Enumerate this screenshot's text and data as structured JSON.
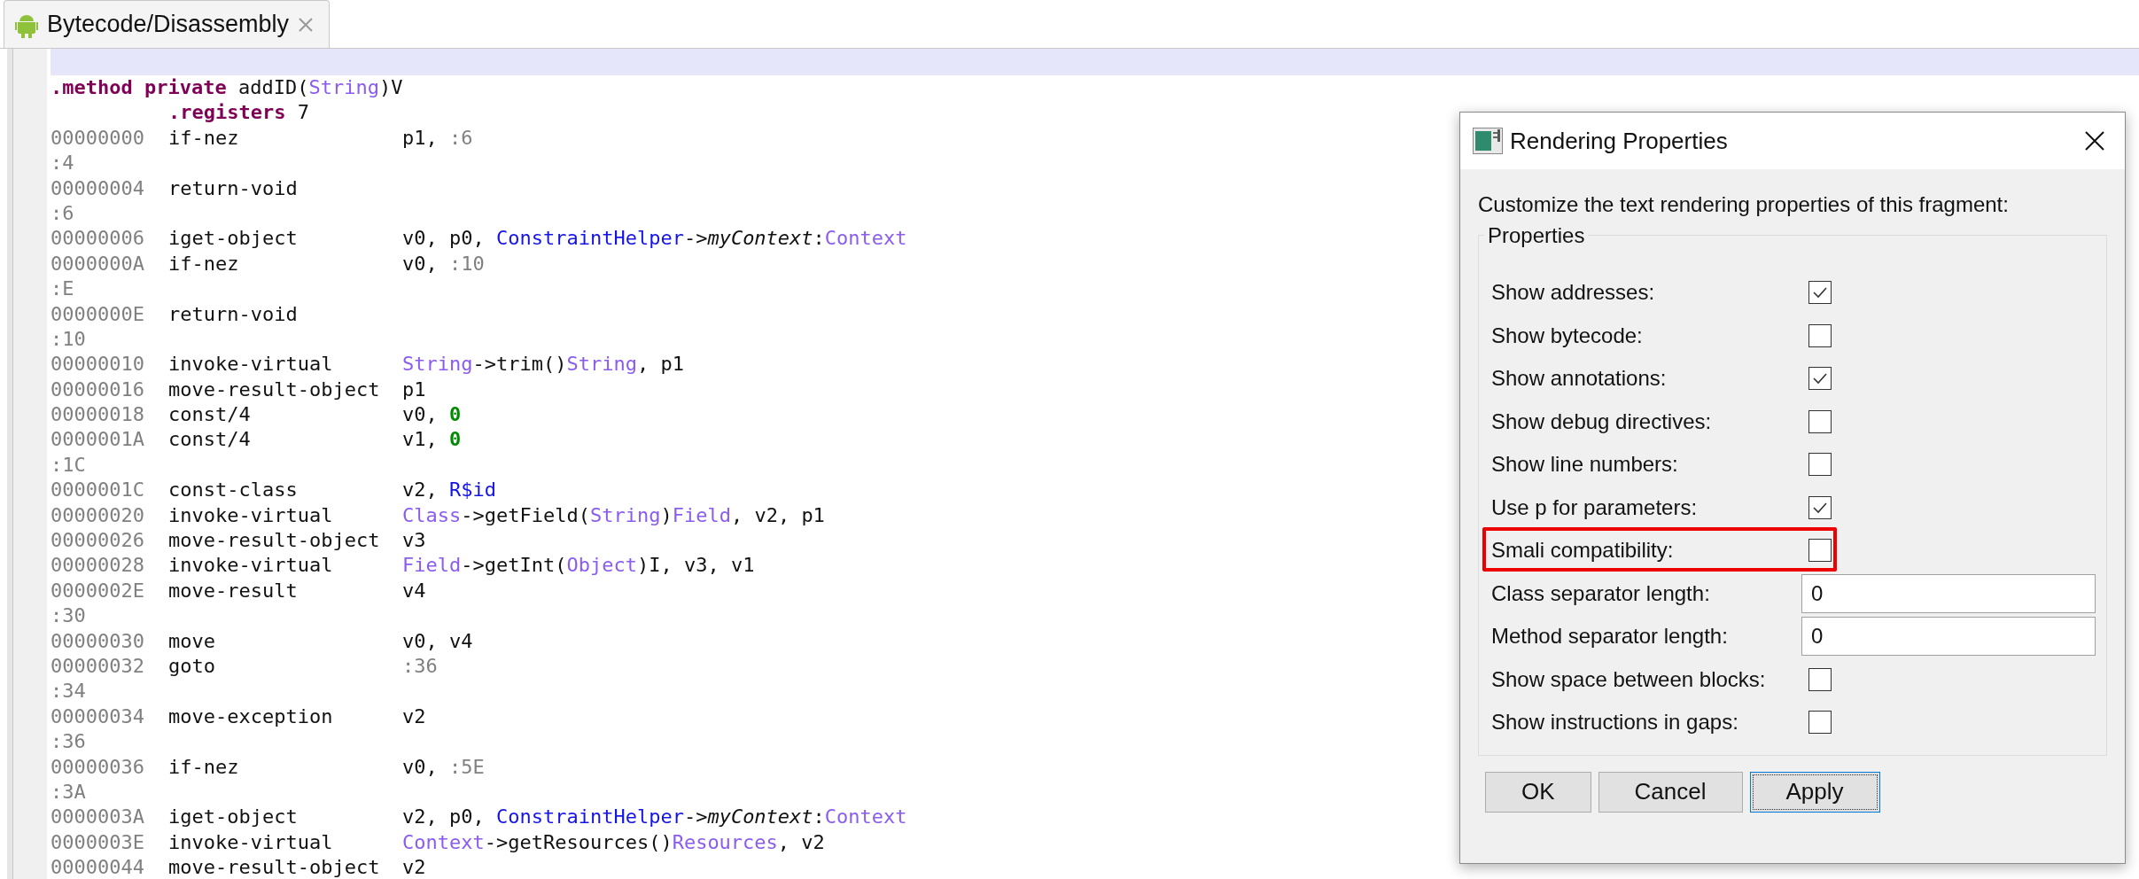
{
  "tab": {
    "title": "Bytecode/Disassembly"
  },
  "code": [
    {
      "kind": "header",
      "tokens": [
        {
          "text": ".method private",
          "kind": "keyword"
        },
        {
          "text": " addID(",
          "kind": "plain"
        },
        {
          "text": "String",
          "kind": "type"
        },
        {
          "text": ")V",
          "kind": "plain"
        }
      ]
    },
    {
      "kind": "directive",
      "tokens": [
        {
          "text": ".registers",
          "kind": "keyword"
        },
        {
          "text": " 7",
          "kind": "plain"
        }
      ]
    },
    {
      "kind": "instruction",
      "address": "00000000",
      "opcode": "if-nez",
      "args": [
        {
          "text": "p1, ",
          "kind": "plain"
        },
        {
          "text": ":6",
          "kind": "label"
        }
      ]
    },
    {
      "kind": "label",
      "text": ":4"
    },
    {
      "kind": "instruction",
      "address": "00000004",
      "opcode": "return-void"
    },
    {
      "kind": "label",
      "text": ":6"
    },
    {
      "kind": "instruction",
      "address": "00000006",
      "opcode": "iget-object",
      "args": [
        {
          "text": "v0, p0, ",
          "kind": "plain"
        },
        {
          "text": "ConstraintHelper",
          "kind": "class"
        },
        {
          "text": "->",
          "kind": "plain"
        },
        {
          "text": "myContext",
          "kind": "field"
        },
        {
          "text": ":",
          "kind": "plain"
        },
        {
          "text": "Context",
          "kind": "type"
        }
      ]
    },
    {
      "kind": "instruction",
      "address": "0000000A",
      "opcode": "if-nez",
      "args": [
        {
          "text": "v0, ",
          "kind": "plain"
        },
        {
          "text": ":10",
          "kind": "label"
        }
      ]
    },
    {
      "kind": "label",
      "text": ":E"
    },
    {
      "kind": "instruction",
      "address": "0000000E",
      "opcode": "return-void"
    },
    {
      "kind": "label",
      "text": ":10"
    },
    {
      "kind": "instruction",
      "address": "00000010",
      "opcode": "invoke-virtual",
      "args": [
        {
          "text": "String",
          "kind": "type"
        },
        {
          "text": "->trim()",
          "kind": "plain"
        },
        {
          "text": "String",
          "kind": "type"
        },
        {
          "text": ", p1",
          "kind": "plain"
        }
      ]
    },
    {
      "kind": "instruction",
      "address": "00000016",
      "opcode": "move-result-object",
      "args": [
        {
          "text": "p1",
          "kind": "plain"
        }
      ]
    },
    {
      "kind": "instruction",
      "address": "00000018",
      "opcode": "const/4",
      "args": [
        {
          "text": "v0, ",
          "kind": "plain"
        },
        {
          "text": "0",
          "kind": "number"
        }
      ]
    },
    {
      "kind": "instruction",
      "address": "0000001A",
      "opcode": "const/4",
      "args": [
        {
          "text": "v1, ",
          "kind": "plain"
        },
        {
          "text": "0",
          "kind": "number"
        }
      ]
    },
    {
      "kind": "label",
      "text": ":1C"
    },
    {
      "kind": "instruction",
      "address": "0000001C",
      "opcode": "const-class",
      "args": [
        {
          "text": "v2, ",
          "kind": "plain"
        },
        {
          "text": "R$id",
          "kind": "class"
        }
      ]
    },
    {
      "kind": "instruction",
      "address": "00000020",
      "opcode": "invoke-virtual",
      "args": [
        {
          "text": "Class",
          "kind": "type"
        },
        {
          "text": "->getField(",
          "kind": "plain"
        },
        {
          "text": "String",
          "kind": "type"
        },
        {
          "text": ")",
          "kind": "plain"
        },
        {
          "text": "Field",
          "kind": "type"
        },
        {
          "text": ", v2, p1",
          "kind": "plain"
        }
      ]
    },
    {
      "kind": "instruction",
      "address": "00000026",
      "opcode": "move-result-object",
      "args": [
        {
          "text": "v3",
          "kind": "plain"
        }
      ]
    },
    {
      "kind": "instruction",
      "address": "00000028",
      "opcode": "invoke-virtual",
      "args": [
        {
          "text": "Field",
          "kind": "type"
        },
        {
          "text": "->getInt(",
          "kind": "plain"
        },
        {
          "text": "Object",
          "kind": "type"
        },
        {
          "text": ")I, v3, v1",
          "kind": "plain"
        }
      ]
    },
    {
      "kind": "instruction",
      "address": "0000002E",
      "opcode": "move-result",
      "args": [
        {
          "text": "v4",
          "kind": "plain"
        }
      ]
    },
    {
      "kind": "label",
      "text": ":30"
    },
    {
      "kind": "instruction",
      "address": "00000030",
      "opcode": "move",
      "args": [
        {
          "text": "v0, v4",
          "kind": "plain"
        }
      ]
    },
    {
      "kind": "instruction",
      "address": "00000032",
      "opcode": "goto",
      "args": [
        {
          "text": ":36",
          "kind": "label"
        }
      ]
    },
    {
      "kind": "label",
      "text": ":34"
    },
    {
      "kind": "instruction",
      "address": "00000034",
      "opcode": "move-exception",
      "args": [
        {
          "text": "v2",
          "kind": "plain"
        }
      ]
    },
    {
      "kind": "label",
      "text": ":36"
    },
    {
      "kind": "instruction",
      "address": "00000036",
      "opcode": "if-nez",
      "args": [
        {
          "text": "v0, ",
          "kind": "plain"
        },
        {
          "text": ":5E",
          "kind": "label"
        }
      ]
    },
    {
      "kind": "label",
      "text": ":3A"
    },
    {
      "kind": "instruction",
      "address": "0000003A",
      "opcode": "iget-object",
      "args": [
        {
          "text": "v2, p0, ",
          "kind": "plain"
        },
        {
          "text": "ConstraintHelper",
          "kind": "class"
        },
        {
          "text": "->",
          "kind": "plain"
        },
        {
          "text": "myContext",
          "kind": "field"
        },
        {
          "text": ":",
          "kind": "plain"
        },
        {
          "text": "Context",
          "kind": "type"
        }
      ]
    },
    {
      "kind": "instruction",
      "address": "0000003E",
      "opcode": "invoke-virtual",
      "args": [
        {
          "text": "Context",
          "kind": "type"
        },
        {
          "text": "->getResources()",
          "kind": "plain"
        },
        {
          "text": "Resources",
          "kind": "type"
        },
        {
          "text": ", v2",
          "kind": "plain"
        }
      ]
    },
    {
      "kind": "instruction",
      "address": "00000044",
      "opcode": "move-result-object",
      "args": [
        {
          "text": "v2",
          "kind": "plain"
        }
      ]
    }
  ],
  "dialog": {
    "title": "Rendering Properties",
    "description": "Customize the text rendering properties of this fragment:",
    "group": "Properties",
    "properties": [
      {
        "label": "Show addresses:",
        "kind": "checkbox",
        "checked": true,
        "highlighted": false
      },
      {
        "label": "Show bytecode:",
        "kind": "checkbox",
        "checked": false,
        "highlighted": false
      },
      {
        "label": "Show annotations:",
        "kind": "checkbox",
        "checked": true,
        "highlighted": false
      },
      {
        "label": "Show debug directives:",
        "kind": "checkbox",
        "checked": false,
        "highlighted": false
      },
      {
        "label": "Show line numbers:",
        "kind": "checkbox",
        "checked": false,
        "highlighted": false
      },
      {
        "label": "Use p for parameters:",
        "kind": "checkbox",
        "checked": true,
        "highlighted": false
      },
      {
        "label": "Smali compatibility:",
        "kind": "checkbox",
        "checked": false,
        "highlighted": true
      },
      {
        "label": "Class separator length:",
        "kind": "number",
        "value": "0",
        "highlighted": false
      },
      {
        "label": "Method separator length:",
        "kind": "number",
        "value": "0",
        "highlighted": false
      },
      {
        "label": "Show space between blocks:",
        "kind": "checkbox",
        "checked": false,
        "highlighted": false
      },
      {
        "label": "Show instructions in gaps:",
        "kind": "checkbox",
        "checked": false,
        "highlighted": false
      }
    ],
    "buttons": [
      {
        "label": "OK",
        "focused": false
      },
      {
        "label": "Cancel",
        "focused": false
      },
      {
        "label": "Apply",
        "focused": true
      }
    ]
  }
}
